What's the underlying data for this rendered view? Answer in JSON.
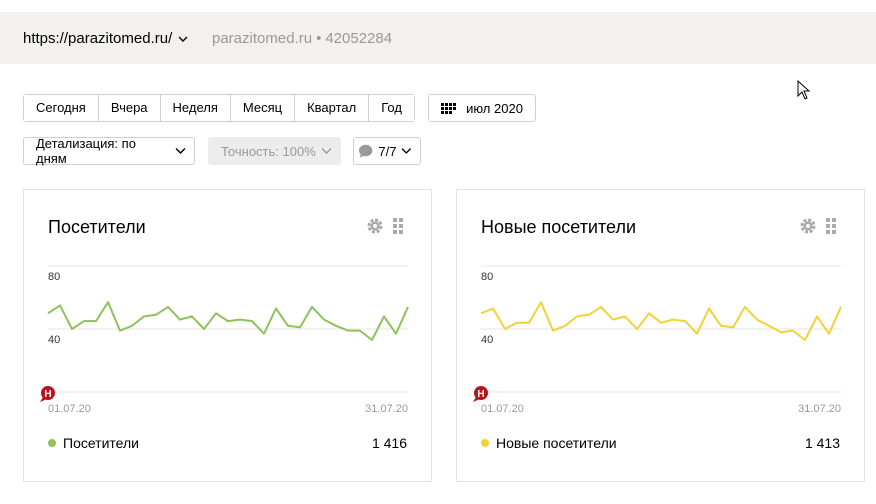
{
  "header": {
    "site_url": "https://parazitomed.ru/",
    "site_name": "parazitomed.ru",
    "separator": "•",
    "counter_id": "42052284"
  },
  "periods": [
    "Сегодня",
    "Вчера",
    "Неделя",
    "Месяц",
    "Квартал",
    "Год"
  ],
  "date_button": {
    "label": "июл 2020",
    "icon": "calendar-icon"
  },
  "controls": {
    "detail_label": "Детализация: по дням",
    "accuracy_label": "Точность: 100%",
    "segments_label": "7/7"
  },
  "colors": {
    "green": "#8dc35a",
    "yellow": "#f2d237",
    "grid": "#e6e6e6",
    "marker": "#b8141b"
  },
  "cards": [
    {
      "title": "Посетители",
      "legend_label": "Посетители",
      "total": "1 416",
      "color": "#8dc35a"
    },
    {
      "title": "Новые посетители",
      "legend_label": "Новые посетители",
      "total": "1 413",
      "color": "#f2d237"
    }
  ],
  "chart_data": [
    {
      "type": "line",
      "ylim": [
        0,
        80
      ],
      "yticks": [
        "80",
        "40"
      ],
      "xticks": [
        "01.07.20",
        "31.07.20"
      ],
      "marker_label": "Н",
      "series": [
        {
          "name": "Посетители",
          "values": [
            50,
            55,
            40,
            45,
            45,
            57,
            39,
            42,
            48,
            49,
            54,
            46,
            48,
            40,
            50,
            45,
            46,
            45,
            37,
            53,
            42,
            41,
            54,
            46,
            42,
            39,
            39,
            33,
            48,
            37,
            54
          ]
        }
      ]
    },
    {
      "type": "line",
      "ylim": [
        0,
        80
      ],
      "yticks": [
        "80",
        "40"
      ],
      "xticks": [
        "01.07.20",
        "31.07.20"
      ],
      "marker_label": "Н",
      "series": [
        {
          "name": "Новые посетители",
          "values": [
            50,
            53,
            40,
            44,
            44,
            57,
            39,
            42,
            48,
            49,
            54,
            46,
            48,
            40,
            50,
            44,
            46,
            45,
            37,
            53,
            42,
            41,
            54,
            46,
            42,
            38,
            39,
            33,
            48,
            37,
            54
          ]
        }
      ]
    }
  ]
}
